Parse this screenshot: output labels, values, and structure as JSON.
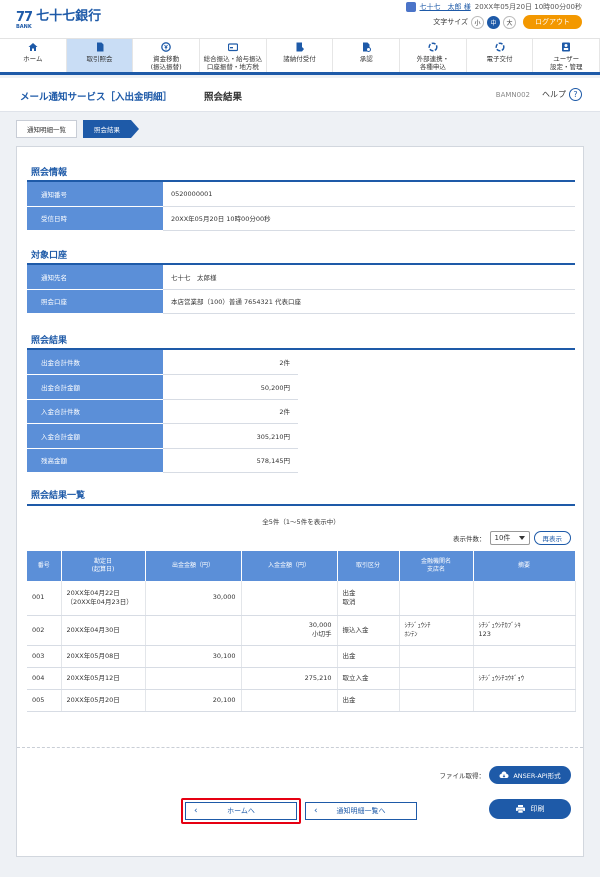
{
  "header": {
    "logo_mark": "77",
    "logo_bank": "BANK",
    "bank_name": "七十七銀行",
    "user_name": "七十七　太郎 様",
    "login_time": "20XX年05月20日 10時00分00秒",
    "font_size_label": "文字サイズ",
    "font_sizes": [
      "小",
      "中",
      "大"
    ],
    "logout": "ログアウト"
  },
  "nav": [
    {
      "icon": "home-icon",
      "label": "ホーム"
    },
    {
      "icon": "document-icon",
      "label": "取引照会"
    },
    {
      "icon": "yen-icon",
      "label": "資金移動\n(振込振替)"
    },
    {
      "icon": "card-icon",
      "label": "総合振込・給与振込\n口座振替・地方税"
    },
    {
      "icon": "request-icon",
      "label": "諸納付受付"
    },
    {
      "icon": "approve-icon",
      "label": "承認"
    },
    {
      "icon": "link-icon",
      "label": "外部連携・\n各種申込"
    },
    {
      "icon": "link-icon",
      "label": "電子交付"
    },
    {
      "icon": "user-settings-icon",
      "label": "ユーザー\n設定・管理"
    }
  ],
  "title": {
    "main": "メール通知サービス［入出金明細］",
    "sub": "照会結果",
    "code": "BAMN002",
    "help": "ヘルプ"
  },
  "breadcrumb": [
    "通知明細一覧",
    "照会結果"
  ],
  "inquiry_info": {
    "title": "照会情報",
    "rows": [
      {
        "k": "通知番号",
        "v": "0520000001"
      },
      {
        "k": "受信日時",
        "v": "20XX年05月20日 10時00分00秒"
      }
    ]
  },
  "account": {
    "title": "対象口座",
    "rows": [
      {
        "k": "通知先名",
        "v": "七十七　太郎様"
      },
      {
        "k": "照会口座",
        "v": "本店営業部（100）普通 7654321 代表口座"
      }
    ]
  },
  "results": {
    "title": "照会結果",
    "rows": [
      {
        "k": "出金合計件数",
        "v": "2件"
      },
      {
        "k": "出金合計金額",
        "v": "50,200円"
      },
      {
        "k": "入金合計件数",
        "v": "2件"
      },
      {
        "k": "入金合計金額",
        "v": "305,210円"
      },
      {
        "k": "残高金額",
        "v": "578,145円"
      }
    ]
  },
  "list": {
    "title": "照会結果一覧",
    "count_text": "全5件（1～5件を表示中）",
    "per_page_label": "表示件数：",
    "per_page_value": "10件",
    "redisplay": "再表示",
    "headers": [
      "番号",
      "勘定日\n(起算日)",
      "出金金額（円）",
      "入金金額（円）",
      "取引区分",
      "金融機関名\n支店名",
      "摘要"
    ],
    "rows": [
      [
        "001",
        "20XX年04月22日\n（20XX年04月23日）",
        "30,000",
        "",
        "出金\n取消",
        "",
        ""
      ],
      [
        "002",
        "20XX年04月30日",
        "",
        "30,000\n小切手",
        "振込入金",
        "ｼﾁｼﾞｭｳｼﾁ\nﾎﾝﾃﾝ",
        "ｼﾁｼﾞｭｳｼﾁｶﾌﾞｼｷ\n123"
      ],
      [
        "003",
        "20XX年05月08日",
        "30,100",
        "",
        "出金",
        "",
        ""
      ],
      [
        "004",
        "20XX年05月12日",
        "",
        "275,210",
        "取立入金",
        "",
        "ｼﾁｼﾞｭｳｼﾁｺｳｷﾞｮｳ"
      ],
      [
        "005",
        "20XX年05月20日",
        "20,100",
        "",
        "出金",
        "",
        ""
      ]
    ]
  },
  "footer": {
    "file_label": "ファイル取得：",
    "api_button": "ANSER-API形式",
    "home_button": "ホームへ",
    "list_button": "通知明細一覧へ",
    "print_button": "印刷"
  },
  "colors": {
    "brand": "#1e5aa8",
    "header_cell": "#5b8fd8",
    "logout": "#f39800",
    "highlight": "#e60012"
  }
}
